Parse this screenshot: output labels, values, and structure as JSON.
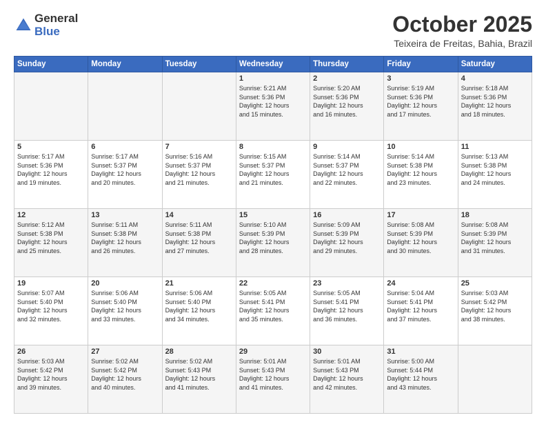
{
  "header": {
    "logo_general": "General",
    "logo_blue": "Blue",
    "month": "October 2025",
    "location": "Teixeira de Freitas, Bahia, Brazil"
  },
  "weekdays": [
    "Sunday",
    "Monday",
    "Tuesday",
    "Wednesday",
    "Thursday",
    "Friday",
    "Saturday"
  ],
  "rows": [
    [
      {
        "day": "",
        "info": ""
      },
      {
        "day": "",
        "info": ""
      },
      {
        "day": "",
        "info": ""
      },
      {
        "day": "1",
        "info": "Sunrise: 5:21 AM\nSunset: 5:36 PM\nDaylight: 12 hours\nand 15 minutes."
      },
      {
        "day": "2",
        "info": "Sunrise: 5:20 AM\nSunset: 5:36 PM\nDaylight: 12 hours\nand 16 minutes."
      },
      {
        "day": "3",
        "info": "Sunrise: 5:19 AM\nSunset: 5:36 PM\nDaylight: 12 hours\nand 17 minutes."
      },
      {
        "day": "4",
        "info": "Sunrise: 5:18 AM\nSunset: 5:36 PM\nDaylight: 12 hours\nand 18 minutes."
      }
    ],
    [
      {
        "day": "5",
        "info": "Sunrise: 5:17 AM\nSunset: 5:36 PM\nDaylight: 12 hours\nand 19 minutes."
      },
      {
        "day": "6",
        "info": "Sunrise: 5:17 AM\nSunset: 5:37 PM\nDaylight: 12 hours\nand 20 minutes."
      },
      {
        "day": "7",
        "info": "Sunrise: 5:16 AM\nSunset: 5:37 PM\nDaylight: 12 hours\nand 21 minutes."
      },
      {
        "day": "8",
        "info": "Sunrise: 5:15 AM\nSunset: 5:37 PM\nDaylight: 12 hours\nand 21 minutes."
      },
      {
        "day": "9",
        "info": "Sunrise: 5:14 AM\nSunset: 5:37 PM\nDaylight: 12 hours\nand 22 minutes."
      },
      {
        "day": "10",
        "info": "Sunrise: 5:14 AM\nSunset: 5:38 PM\nDaylight: 12 hours\nand 23 minutes."
      },
      {
        "day": "11",
        "info": "Sunrise: 5:13 AM\nSunset: 5:38 PM\nDaylight: 12 hours\nand 24 minutes."
      }
    ],
    [
      {
        "day": "12",
        "info": "Sunrise: 5:12 AM\nSunset: 5:38 PM\nDaylight: 12 hours\nand 25 minutes."
      },
      {
        "day": "13",
        "info": "Sunrise: 5:11 AM\nSunset: 5:38 PM\nDaylight: 12 hours\nand 26 minutes."
      },
      {
        "day": "14",
        "info": "Sunrise: 5:11 AM\nSunset: 5:38 PM\nDaylight: 12 hours\nand 27 minutes."
      },
      {
        "day": "15",
        "info": "Sunrise: 5:10 AM\nSunset: 5:39 PM\nDaylight: 12 hours\nand 28 minutes."
      },
      {
        "day": "16",
        "info": "Sunrise: 5:09 AM\nSunset: 5:39 PM\nDaylight: 12 hours\nand 29 minutes."
      },
      {
        "day": "17",
        "info": "Sunrise: 5:08 AM\nSunset: 5:39 PM\nDaylight: 12 hours\nand 30 minutes."
      },
      {
        "day": "18",
        "info": "Sunrise: 5:08 AM\nSunset: 5:39 PM\nDaylight: 12 hours\nand 31 minutes."
      }
    ],
    [
      {
        "day": "19",
        "info": "Sunrise: 5:07 AM\nSunset: 5:40 PM\nDaylight: 12 hours\nand 32 minutes."
      },
      {
        "day": "20",
        "info": "Sunrise: 5:06 AM\nSunset: 5:40 PM\nDaylight: 12 hours\nand 33 minutes."
      },
      {
        "day": "21",
        "info": "Sunrise: 5:06 AM\nSunset: 5:40 PM\nDaylight: 12 hours\nand 34 minutes."
      },
      {
        "day": "22",
        "info": "Sunrise: 5:05 AM\nSunset: 5:41 PM\nDaylight: 12 hours\nand 35 minutes."
      },
      {
        "day": "23",
        "info": "Sunrise: 5:05 AM\nSunset: 5:41 PM\nDaylight: 12 hours\nand 36 minutes."
      },
      {
        "day": "24",
        "info": "Sunrise: 5:04 AM\nSunset: 5:41 PM\nDaylight: 12 hours\nand 37 minutes."
      },
      {
        "day": "25",
        "info": "Sunrise: 5:03 AM\nSunset: 5:42 PM\nDaylight: 12 hours\nand 38 minutes."
      }
    ],
    [
      {
        "day": "26",
        "info": "Sunrise: 5:03 AM\nSunset: 5:42 PM\nDaylight: 12 hours\nand 39 minutes."
      },
      {
        "day": "27",
        "info": "Sunrise: 5:02 AM\nSunset: 5:42 PM\nDaylight: 12 hours\nand 40 minutes."
      },
      {
        "day": "28",
        "info": "Sunrise: 5:02 AM\nSunset: 5:43 PM\nDaylight: 12 hours\nand 41 minutes."
      },
      {
        "day": "29",
        "info": "Sunrise: 5:01 AM\nSunset: 5:43 PM\nDaylight: 12 hours\nand 41 minutes."
      },
      {
        "day": "30",
        "info": "Sunrise: 5:01 AM\nSunset: 5:43 PM\nDaylight: 12 hours\nand 42 minutes."
      },
      {
        "day": "31",
        "info": "Sunrise: 5:00 AM\nSunset: 5:44 PM\nDaylight: 12 hours\nand 43 minutes."
      },
      {
        "day": "",
        "info": ""
      }
    ]
  ]
}
